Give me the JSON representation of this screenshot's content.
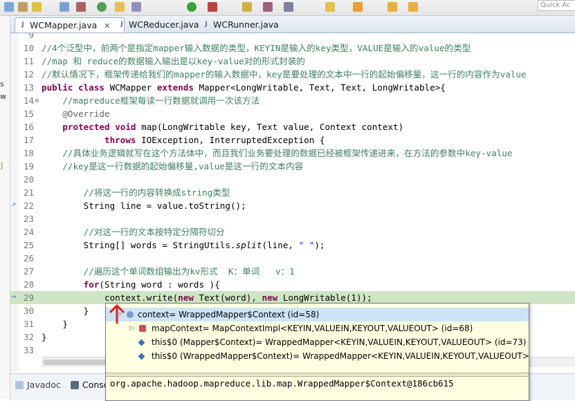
{
  "toolbar": {
    "quick_access": "Quick Ac",
    "icons": [
      "toolbar-icon-a",
      "toolbar-icon-b",
      "toolbar-icon-c",
      "toolbar-icon-d",
      "toolbar-icon-e"
    ]
  },
  "left_strip": {
    "frag1": "s",
    "frag2": "w",
    "frag3": "]"
  },
  "tabs": [
    {
      "label": "WCMapper.java",
      "active": true,
      "close": "✕"
    },
    {
      "label": "WCReducer.java",
      "active": false
    },
    {
      "label": "WCRunner.java",
      "active": false
    }
  ],
  "code": {
    "l9": "9",
    "l10": "10",
    "l11": "11",
    "l12": "12",
    "l13": "13",
    "l14": "14",
    "l15": "15",
    "l16": "16",
    "l17": "17",
    "l18": "18",
    "l19": "19",
    "l20": "20",
    "l21": "21",
    "l22": "22",
    "l23": "23",
    "l24": "24",
    "l25": "25",
    "l26": "26",
    "l27": "27",
    "l28": "28",
    "l29": "29",
    "l30": "30",
    "l31": "31",
    "l32": "32",
    "l33": "33",
    "c10": "//4个泛型中，前两个是指定mapper输入数据的类型，KEYIN是输入的key类型，VALUE是输入的value的类型",
    "c11": "//map 和 reduce的数据输入输出是以key-value对的形式封装的",
    "c12": "//默认情况下，框架传递给我们的mapper的输入数据中，key是要处理的文本中一行的起始偏移量，这一行的内容作为value",
    "c13_kw1": "public",
    "c13_kw2": "class",
    "c13_name": " WCMapper ",
    "c13_kw3": "extends",
    "c13_rest": " Mapper<LongWritable, Text, Text, LongWritable>{",
    "c14": "    //mapreduce框架每读一行数据就调用一次该方法",
    "c15": "    @Override",
    "c16_kw1": "protected",
    "c16_kw2": "void",
    "c16_rest": " map(LongWritable key, Text value, Context context)",
    "c17_kw": "throws",
    "c17_rest": " IOException, InterruptedException {",
    "c18": "    //具体业务逻辑就写在这个方法体中，而且我们业务要处理的数据已经被框架传递进来，在方法的参数中key-value",
    "c19": "    //key是这一行数据的起始偏移量,value是这一行的文本内容",
    "c21": "        //将这一行的内容转换成string类型",
    "c22_a": "String line = value.toString();",
    "c24": "        //对这一行的文本按特定分隔符切分",
    "c25_a": "String[] words = StringUtils.",
    "c25_b": "split",
    "c25_c": "(line, ",
    "c25_str": "\" \"",
    "c25_d": ");",
    "c27": "        //遍历这个单词数组输出为kv形式  K：单词   v：1",
    "c28_kw": "for",
    "c28_rest": "(String word : words ){",
    "c29_a": "context.write(",
    "c29_kw1": "new",
    "c29_b": " Text(word), ",
    "c29_kw2": "new",
    "c29_c": " LongWritable(1));",
    "c30": "        }",
    "c31": "    }",
    "c32": "}"
  },
  "popup": {
    "rows": [
      {
        "label": "context= WrappedMapper$Context  (id=58)"
      },
      {
        "label": "mapContext= MapContextImpl<KEYIN,VALUEIN,KEYOUT,VALUEOUT>  (id=68)"
      },
      {
        "label": "this$0 (Mapper$Context)= WrappedMapper<KEYIN,VALUEIN,KEYOUT,VALUEOUT>  (id=73)"
      },
      {
        "label": "this$0 (WrappedMapper$Context)= WrappedMapper<KEYIN,VALUEIN,KEYOUT,VALUEOUT>  ("
      }
    ],
    "detail": "org.apache.hadoop.mapreduce.lib.map.WrappedMapper$Context@186cb615"
  },
  "bottom_tabs": [
    {
      "label": "Javadoc"
    },
    {
      "label": "Conso"
    }
  ],
  "colors": {
    "keyword": "#7f0055",
    "comment": "#3f7f5f",
    "annotation": "#646464",
    "string": "#2a00ff",
    "highlight_line": "#cfe6c4",
    "popup_bg": "#ffffe1"
  }
}
